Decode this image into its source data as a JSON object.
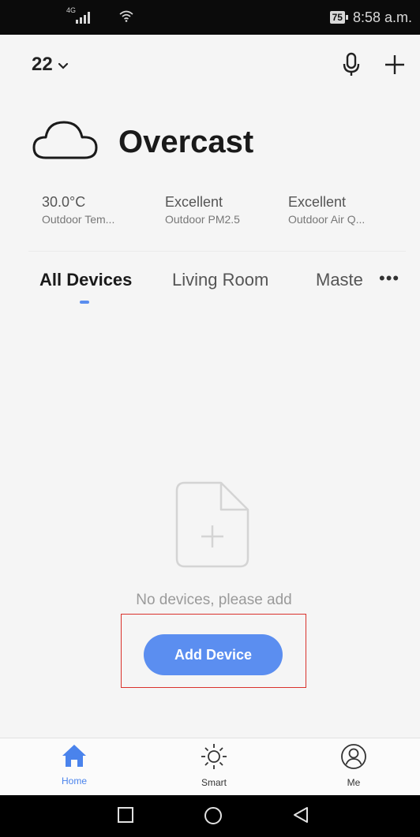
{
  "status_bar": {
    "network": "4G",
    "battery": "75",
    "time": "8:58 a.m."
  },
  "header": {
    "home_name": "22",
    "icons": [
      "chevron-down-icon",
      "microphone-icon",
      "plus-icon"
    ]
  },
  "weather": {
    "icon": "cloud-icon",
    "condition": "Overcast"
  },
  "stats": [
    {
      "value": "30.0°C",
      "label": "Outdoor Tem..."
    },
    {
      "value": "Excellent",
      "label": "Outdoor PM2.5"
    },
    {
      "value": "Excellent",
      "label": "Outdoor Air Q..."
    }
  ],
  "tabs": {
    "items": [
      {
        "label": "All Devices",
        "active": true
      },
      {
        "label": "Living Room",
        "active": false
      },
      {
        "label": "Maste",
        "active": false
      }
    ],
    "more": "•••"
  },
  "empty_state": {
    "icon": "add-file-icon",
    "message": "No devices, please add",
    "button_label": "Add Device"
  },
  "bottom_nav": [
    {
      "label": "Home",
      "icon": "home-icon",
      "active": true
    },
    {
      "label": "Smart",
      "icon": "sun-icon",
      "active": false
    },
    {
      "label": "Me",
      "icon": "user-icon",
      "active": false
    }
  ],
  "colors": {
    "accent": "#5b8ef0",
    "background": "#f5f5f5",
    "highlight_border": "#d9322c"
  }
}
